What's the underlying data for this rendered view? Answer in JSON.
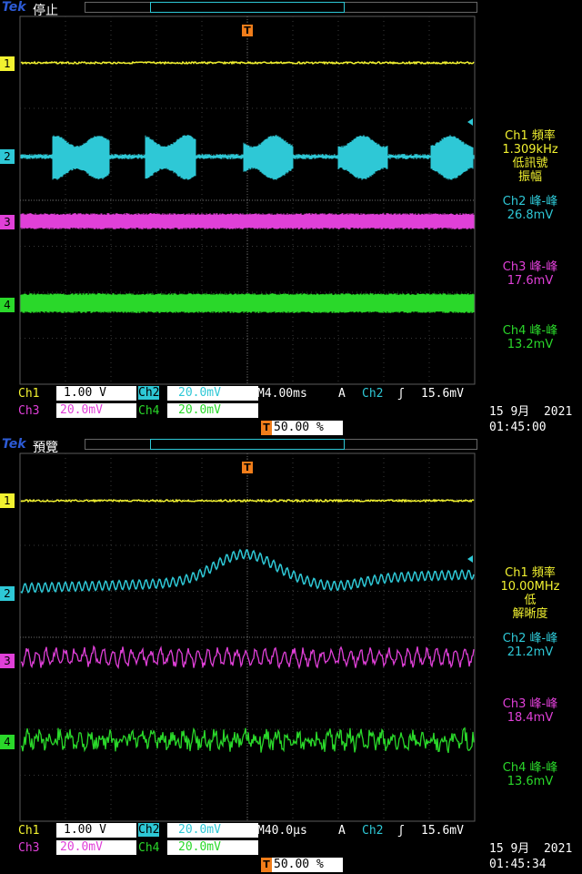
{
  "colors": {
    "ch1": "#f2f230",
    "ch2": "#2ec8d6",
    "ch3": "#e040d8",
    "ch4": "#2ad82a",
    "trigger": "#f07d1a",
    "brand": "#2d5bd6"
  },
  "screens": [
    {
      "brand": "Tek",
      "state": "停止",
      "channel_markers": [
        "1",
        "2",
        "3",
        "4"
      ],
      "readouts": {
        "ch1": {
          "title": "Ch1 頻率",
          "value": "1.309kHz",
          "note1": "低訊號",
          "note2": "振幅"
        },
        "ch2": {
          "title": "Ch2 峰-峰",
          "value": "26.8mV"
        },
        "ch3": {
          "title": "Ch3 峰-峰",
          "value": "17.6mV"
        },
        "ch4": {
          "title": "Ch4 峰-峰",
          "value": "13.2mV"
        }
      },
      "settings": {
        "ch1_label": "Ch1",
        "ch1_scale": "1.00 V",
        "ch2_label": "Ch2",
        "ch2_scale": "20.0mV",
        "ch3_label": "Ch3",
        "ch3_scale": "20.0mV",
        "ch4_label": "Ch4",
        "ch4_scale": "20.0mV",
        "timebase": "M4.00ms",
        "trigger_mode": "A",
        "trigger_source": "Ch2",
        "trigger_level": "15.6mV",
        "trigger_position": "50.00 %"
      },
      "date": "15 9月  2021",
      "time": "01:45:00"
    },
    {
      "brand": "Tek",
      "state": "預覽",
      "channel_markers": [
        "1",
        "2",
        "3",
        "4"
      ],
      "readouts": {
        "ch1": {
          "title": "Ch1 頻率",
          "value": "10.00MHz",
          "note1": "低",
          "note2": "解晰度"
        },
        "ch2": {
          "title": "Ch2 峰-峰",
          "value": "21.2mV"
        },
        "ch3": {
          "title": "Ch3 峰-峰",
          "value": "18.4mV"
        },
        "ch4": {
          "title": "Ch4 峰-峰",
          "value": "13.6mV"
        }
      },
      "settings": {
        "ch1_label": "Ch1",
        "ch1_scale": "1.00 V",
        "ch2_label": "Ch2",
        "ch2_scale": "20.0mV",
        "ch3_label": "Ch3",
        "ch3_scale": "20.0mV",
        "ch4_label": "Ch4",
        "ch4_scale": "20.0mV",
        "timebase": "M40.0µs",
        "trigger_mode": "A",
        "trigger_source": "Ch2",
        "trigger_level": "15.6mV",
        "trigger_position": "50.00 %"
      },
      "date": "15 9月  2021",
      "time": "01:45:34"
    }
  ]
}
